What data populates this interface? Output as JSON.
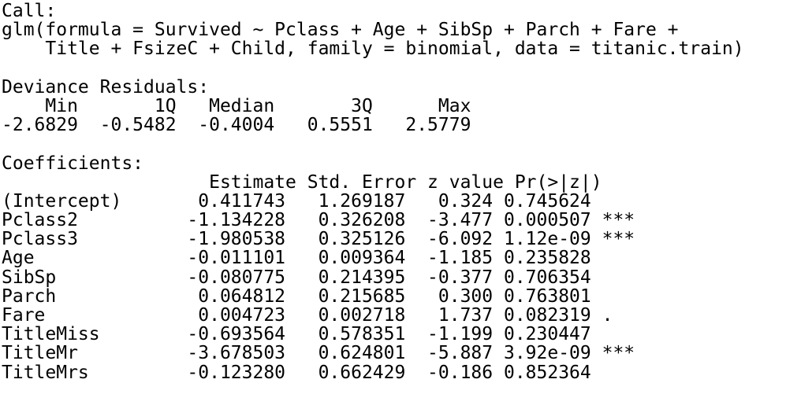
{
  "console": {
    "lines": [
      "Call:",
      "glm(formula = Survived ~ Pclass + Age + SibSp + Parch + Fare +",
      "    Title + FsizeC + Child, family = binomial, data = titanic.train)",
      "",
      "Deviance Residuals:",
      "    Min       1Q   Median       3Q      Max  ",
      "-2.6829  -0.5482  -0.4004   0.5551   2.5779  ",
      "",
      "Coefficients:",
      "                   Estimate Std. Error z value Pr(>|z|)    ",
      "(Intercept)       0.411743   1.269187   0.324 0.745624    ",
      "Pclass2          -1.134228   0.326208  -3.477 0.000507 ***",
      "Pclass3          -1.980538   0.325126  -6.092 1.12e-09 ***",
      "Age              -0.011101   0.009364  -1.185 0.235828    ",
      "SibSp            -0.080775   0.214395  -0.377 0.706354    ",
      "Parch             0.064812   0.215685   0.300 0.763801    ",
      "Fare              0.004723   0.002718   1.737 0.082319 .  ",
      "TitleMiss        -0.693564   0.578351  -1.199 0.230447    ",
      "TitleMr          -3.678503   0.624801  -5.887 3.92e-09 ***",
      "TitleMrs         -0.123280   0.662429  -0.186 0.852364    "
    ]
  }
}
